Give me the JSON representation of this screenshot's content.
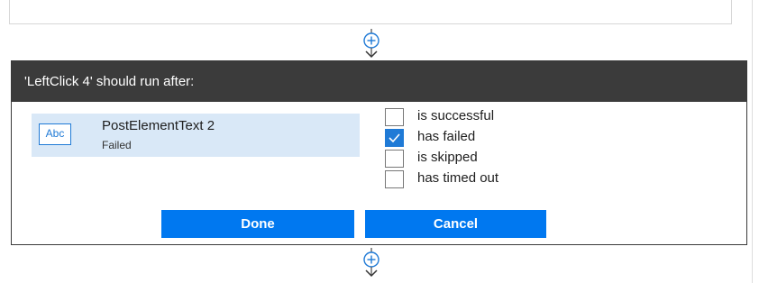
{
  "dialog": {
    "title": "'LeftClick 4' should run after:",
    "step": {
      "icon": "abc-text-icon",
      "icon_text": "Abc",
      "name": "PostElementText 2",
      "status": "Failed"
    },
    "options": [
      {
        "label": "is successful",
        "checked": false
      },
      {
        "label": "has failed",
        "checked": true
      },
      {
        "label": "is skipped",
        "checked": false
      },
      {
        "label": "has timed out",
        "checked": false
      }
    ],
    "buttons": {
      "done": "Done",
      "cancel": "Cancel"
    }
  },
  "connectors": [
    {
      "icon": "add-step-icon"
    },
    {
      "icon": "add-step-icon"
    }
  ],
  "colors": {
    "header_bg": "#3b3b3b",
    "accent": "#0078f0",
    "step_card_bg": "#d9e8f7"
  }
}
